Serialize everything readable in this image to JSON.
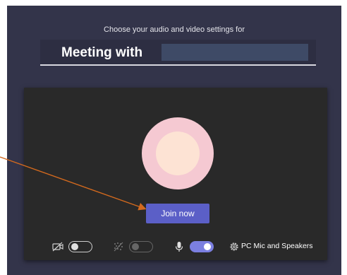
{
  "prejoin": {
    "subtitle": "Choose your audio and video settings for",
    "meeting_title": "Meeting with",
    "join_label": "Join now",
    "audio_device_label": "PC Mic and Speakers"
  },
  "controls": {
    "camera_on": false,
    "background_blur_on": false,
    "microphone_on": true
  },
  "colors": {
    "window_bg": "#33344a",
    "preview_bg": "#292929",
    "accent": "#5b5fc7",
    "avatar_ring": "#f5c9d2",
    "avatar_inner": "#fde3d4",
    "annotation_arrow": "#d2691e"
  },
  "icons": {
    "camera": "camera-off-icon",
    "background": "background-blur-icon",
    "microphone": "microphone-icon",
    "device_settings": "gear-icon"
  }
}
